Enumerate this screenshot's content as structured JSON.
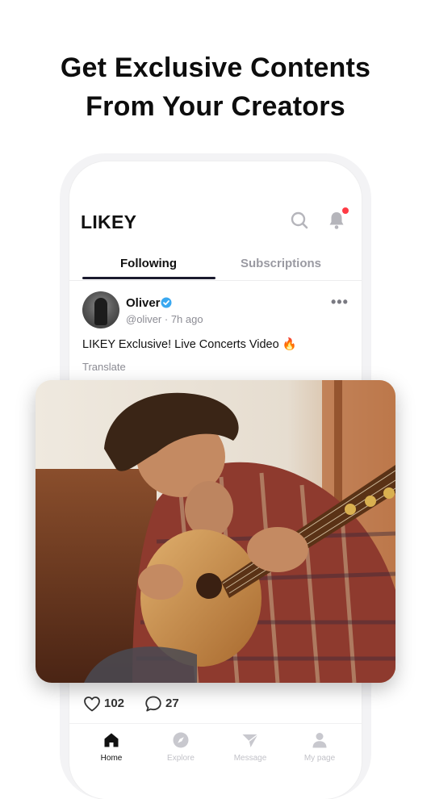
{
  "headline": {
    "line1": "Get Exclusive Contents",
    "line2": "From Your Creators"
  },
  "app": {
    "logo": "LIKEY",
    "header_icons": [
      "search-icon",
      "bell-icon"
    ],
    "notification_dot_color": "#ff3b45"
  },
  "tabs": {
    "following": "Following",
    "subscriptions": "Subscriptions",
    "active": "Following"
  },
  "post": {
    "author": "Oliver",
    "verified": true,
    "handle_time": "@oliver · 7h ago",
    "text": "LIKEY Exclusive! Live Concerts Video 🔥",
    "translate": "Translate",
    "media": "photo of a man playing an acoustic guitar",
    "likes": "102",
    "comments": "27"
  },
  "tabbar": {
    "items": [
      {
        "label": "Home",
        "icon": "home-icon",
        "active": true
      },
      {
        "label": "Explore",
        "icon": "compass-icon",
        "active": false
      },
      {
        "label": "Message",
        "icon": "send-icon",
        "active": false
      },
      {
        "label": "My page",
        "icon": "person-icon",
        "active": false
      }
    ]
  },
  "colors": {
    "accent": "#1a1a2e",
    "verified": "#3aa8f0",
    "muted": "#8c8c94"
  }
}
